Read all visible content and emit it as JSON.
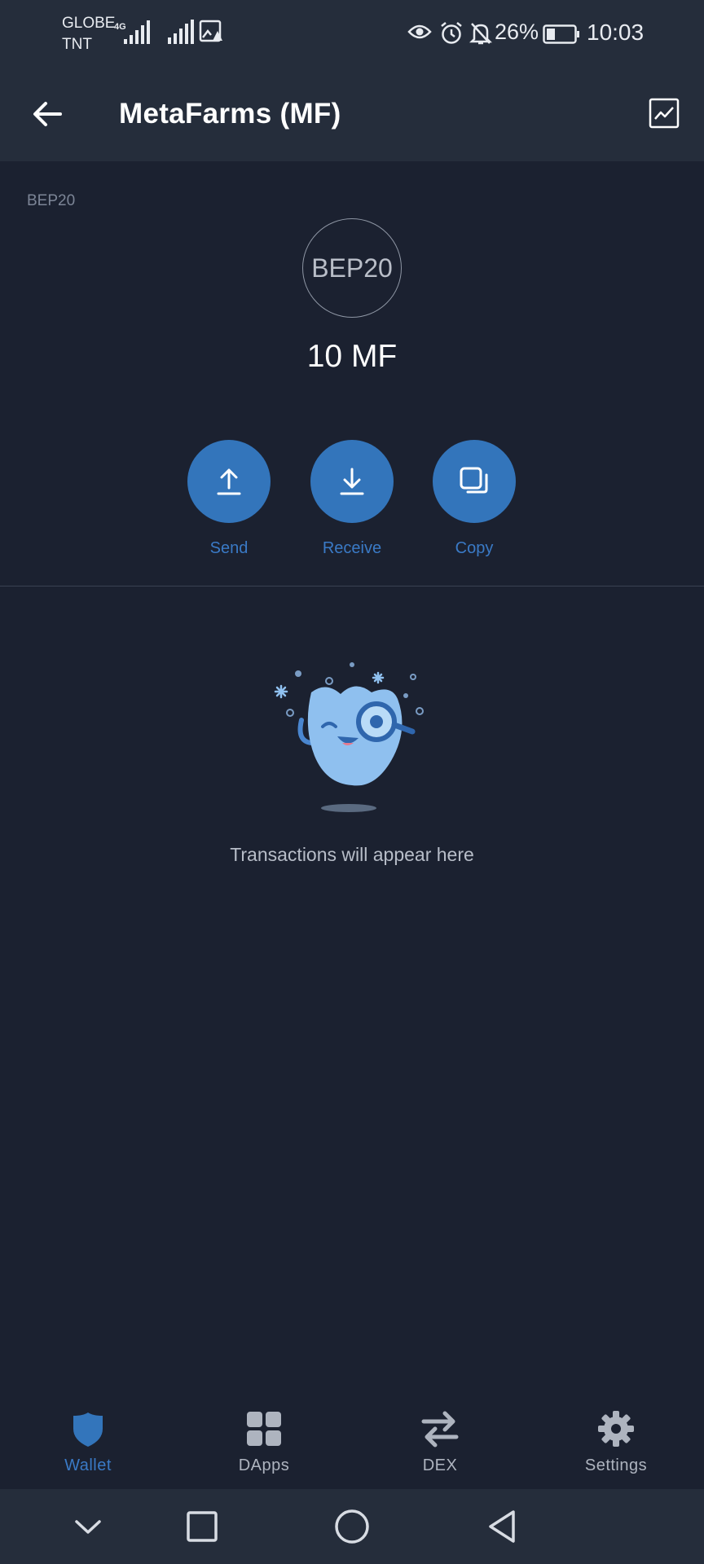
{
  "status_bar": {
    "carrier_1": "GLOBE",
    "carrier_2": "TNT",
    "network_type": "4G",
    "battery": "26%",
    "time": "10:03",
    "icons": [
      "signal-icon",
      "signal-icon",
      "image-alert-icon",
      "eye-icon",
      "alarm-icon",
      "bell-off-icon",
      "battery-icon"
    ]
  },
  "header": {
    "back_icon": "arrow-left-icon",
    "title": "MetaFarms (MF)",
    "chart_icon": "chart-icon"
  },
  "token": {
    "network": "BEP20",
    "logo_text": "BEP20",
    "balance": "10 MF"
  },
  "actions": [
    {
      "label": "Send",
      "icon": "upload-icon"
    },
    {
      "label": "Receive",
      "icon": "download-icon"
    },
    {
      "label": "Copy",
      "icon": "copy-icon"
    }
  ],
  "empty_state": {
    "message": "Transactions will appear here",
    "illustration": "mascot-magnifier-illustration"
  },
  "bottom_nav": [
    {
      "label": "Wallet",
      "icon": "shield-icon",
      "active": true
    },
    {
      "label": "DApps",
      "icon": "grid-icon",
      "active": false
    },
    {
      "label": "DEX",
      "icon": "swap-icon",
      "active": false
    },
    {
      "label": "Settings",
      "icon": "gear-icon",
      "active": false
    }
  ],
  "colors": {
    "background": "#1b2130",
    "bar": "#252d3b",
    "accent": "#3375bb",
    "accent_text": "#3a7ac6"
  }
}
